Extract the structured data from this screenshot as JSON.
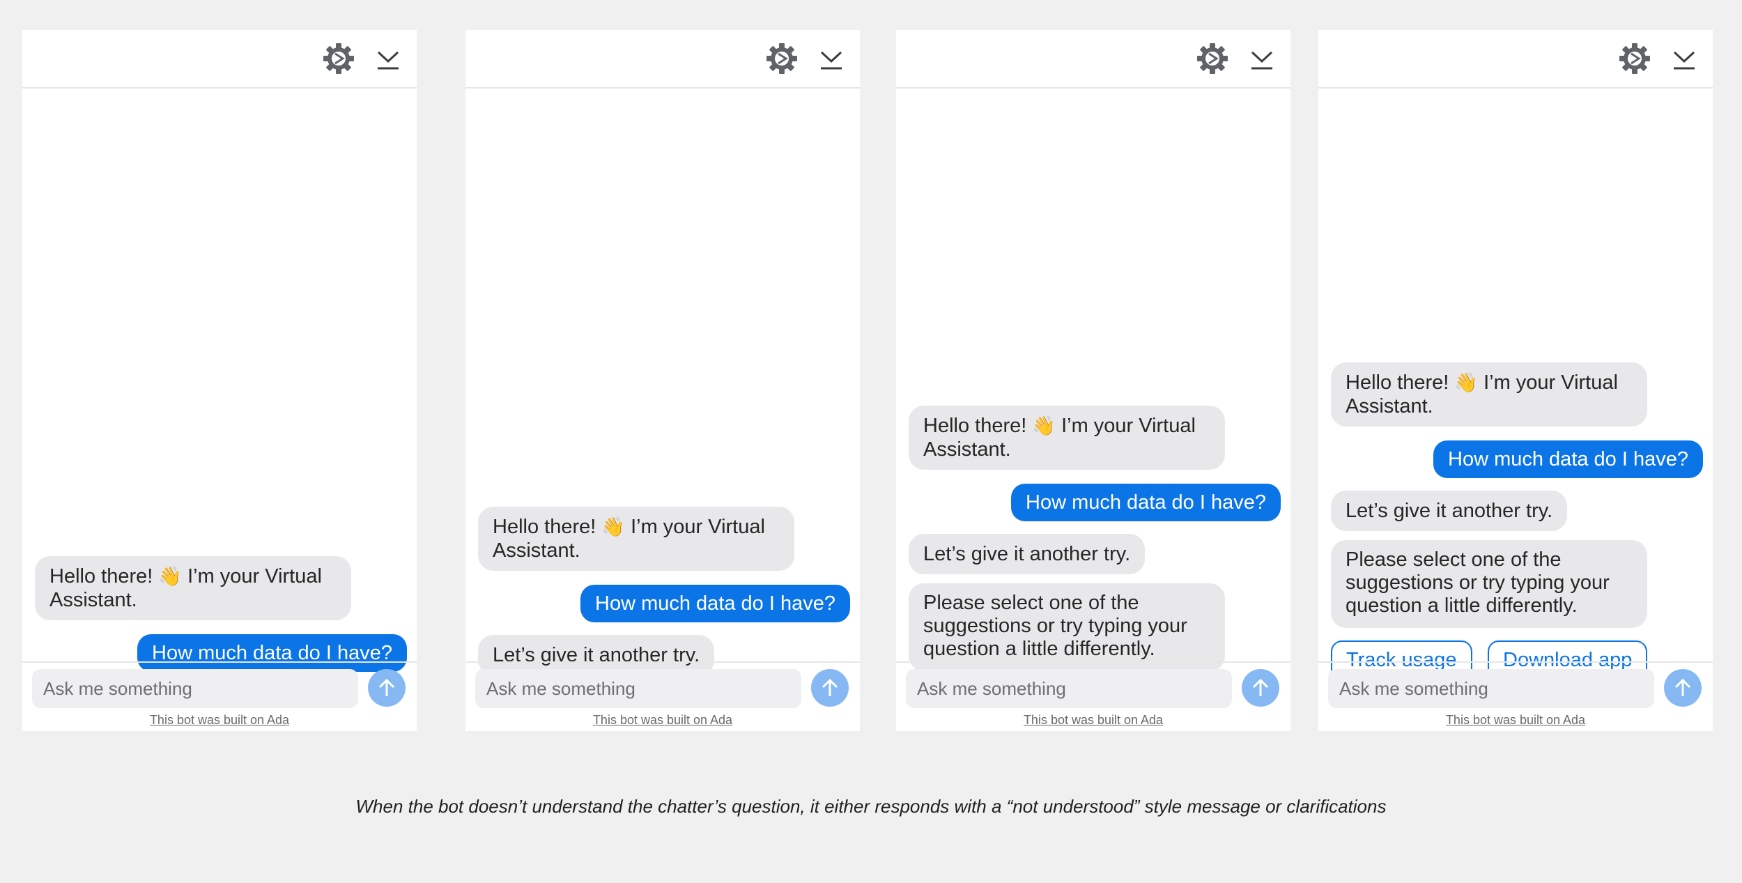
{
  "icons": {
    "settings": "gear-icon",
    "minimize": "chevron-down-icon",
    "send": "arrow-up-icon",
    "wave": "waving-hand-emoji"
  },
  "colors": {
    "background": "#f0f0f0",
    "user_bubble": "#0b74e6",
    "bot_bubble": "#e8e8ea",
    "send_button": "#86b9f3"
  },
  "panels": [
    {
      "messages": [
        {
          "from": "bot",
          "text_a": "Hello there!",
          "emoji": "👋",
          "text_b": "I’m your Virtual Assistant."
        },
        {
          "from": "user",
          "text": "How much data do I have?"
        }
      ]
    },
    {
      "messages": [
        {
          "from": "bot",
          "text_a": "Hello there!",
          "emoji": "👋",
          "text_b": "I’m your Virtual Assistant."
        },
        {
          "from": "user",
          "text": "How much data do I have?"
        },
        {
          "from": "bot",
          "text": "Let’s give it another try."
        }
      ]
    },
    {
      "messages": [
        {
          "from": "bot",
          "text_a": "Hello there!",
          "emoji": "👋",
          "text_b": "I’m your Virtual Assistant."
        },
        {
          "from": "user",
          "text": "How much data do I have?"
        },
        {
          "from": "bot",
          "text": "Let’s give it another try."
        },
        {
          "from": "bot",
          "text": "Please select one of the suggestions or try typing your question a little differently."
        }
      ]
    },
    {
      "messages": [
        {
          "from": "bot",
          "text_a": "Hello there!",
          "emoji": "👋",
          "text_b": "I’m your Virtual Assistant."
        },
        {
          "from": "user",
          "text": "How much data do I have?"
        },
        {
          "from": "bot",
          "text": "Let’s give it another try."
        },
        {
          "from": "bot",
          "text": "Please select one of the suggestions or try typing your question a little differently."
        }
      ],
      "suggestions": [
        "Track usage",
        "Download app"
      ]
    }
  ],
  "composer": {
    "placeholder": "Ask me something",
    "credit": "This bot was built on Ada"
  },
  "caption": "When the bot doesn’t understand the chatter’s question, it either responds with a “not understood” style message or clarifications"
}
